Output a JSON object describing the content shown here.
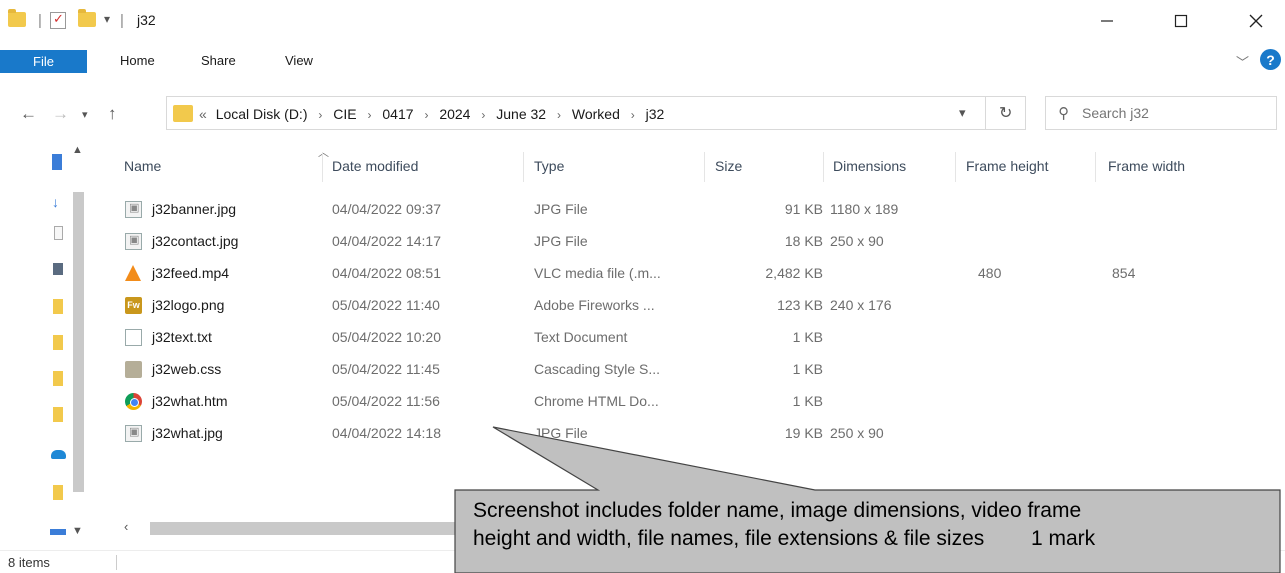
{
  "window": {
    "title": "j32",
    "qa_separator": "|",
    "qa_dropdown": "▾"
  },
  "ribbon": {
    "tabs": [
      "File",
      "Home",
      "Share",
      "View"
    ],
    "help_label": "?"
  },
  "address": {
    "overflow": "«",
    "breadcrumbs": [
      "Local Disk (D:)",
      "CIE",
      "0417",
      "2024",
      "June 32",
      "Worked",
      "j32"
    ],
    "search_placeholder": "Search j32"
  },
  "file_list": {
    "columns": [
      "Name",
      "Date modified",
      "Type",
      "Size",
      "Dimensions",
      "Frame height",
      "Frame width"
    ],
    "rows": [
      {
        "icon": "jpg-file-icon",
        "name": "j32banner.jpg",
        "date": "04/04/2022 09:37",
        "type": "JPG File",
        "size": "91 KB",
        "dimensions": "1180 x 189",
        "frame_height": "",
        "frame_width": ""
      },
      {
        "icon": "jpg-file-icon",
        "name": "j32contact.jpg",
        "date": "04/04/2022 14:17",
        "type": "JPG File",
        "size": "18 KB",
        "dimensions": "250 x 90",
        "frame_height": "",
        "frame_width": ""
      },
      {
        "icon": "vlc-icon",
        "name": "j32feed.mp4",
        "date": "04/04/2022 08:51",
        "type": "VLC media file (.m...",
        "size": "2,482 KB",
        "dimensions": "",
        "frame_height": "480",
        "frame_width": "854"
      },
      {
        "icon": "fireworks-icon",
        "name": "j32logo.png",
        "date": "05/04/2022 11:40",
        "type": "Adobe Fireworks ...",
        "size": "123 KB",
        "dimensions": "240 x 176",
        "frame_height": "",
        "frame_width": ""
      },
      {
        "icon": "text-file-icon",
        "name": "j32text.txt",
        "date": "05/04/2022 10:20",
        "type": "Text Document",
        "size": "1 KB",
        "dimensions": "",
        "frame_height": "",
        "frame_width": ""
      },
      {
        "icon": "css-file-icon",
        "name": "j32web.css",
        "date": "05/04/2022 11:45",
        "type": "Cascading Style S...",
        "size": "1 KB",
        "dimensions": "",
        "frame_height": "",
        "frame_width": ""
      },
      {
        "icon": "chrome-icon",
        "name": "j32what.htm",
        "date": "05/04/2022 11:56",
        "type": "Chrome HTML Do...",
        "size": "1 KB",
        "dimensions": "",
        "frame_height": "",
        "frame_width": ""
      },
      {
        "icon": "jpg-file-icon",
        "name": "j32what.jpg",
        "date": "04/04/2022 14:18",
        "type": "JPG File",
        "size": "19 KB",
        "dimensions": "250 x 90",
        "frame_height": "",
        "frame_width": ""
      }
    ]
  },
  "status": {
    "item_count": "8 items"
  },
  "annotation": {
    "text": "Screenshot includes folder name, image dimensions, video frame\nheight and width, file names, file extensions & file sizes        1 mark"
  },
  "colors": {
    "accent": "#1979ca",
    "folder": "#f2c94c",
    "callout_fill": "#c0c0c0"
  }
}
